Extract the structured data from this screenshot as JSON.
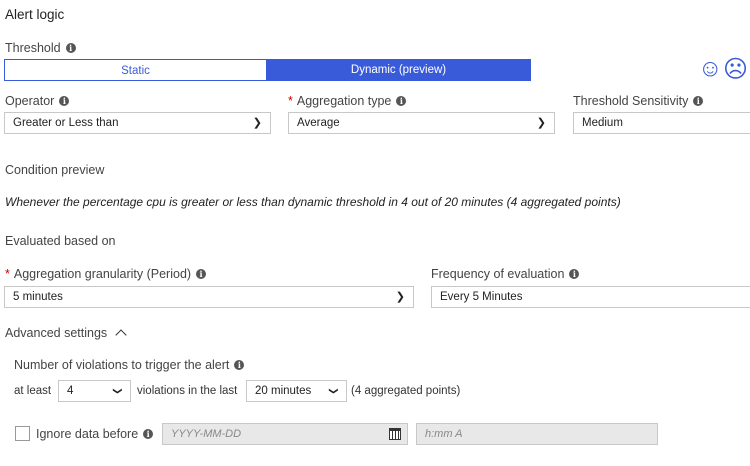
{
  "title": "Alert logic",
  "threshold": {
    "label": "Threshold",
    "options": [
      "Static",
      "Dynamic (preview)"
    ],
    "selected": "Dynamic (preview)",
    "accent": "#3a5bd9"
  },
  "feedback": {
    "positive": "☺",
    "negative": "☹"
  },
  "operator": {
    "label": "Operator",
    "value": "Greater or Less than"
  },
  "aggregation_type": {
    "label": "Aggregation type",
    "value": "Average"
  },
  "sensitivity": {
    "label": "Threshold Sensitivity",
    "value": "Medium"
  },
  "condition": {
    "heading": "Condition preview",
    "text": "Whenever the percentage cpu is greater or less than dynamic threshold in 4 out of 20 minutes (4 aggregated points)"
  },
  "evaluated": {
    "heading": "Evaluated based on",
    "granularity_label": "Aggregation granularity (Period)",
    "granularity_value": "5 minutes",
    "frequency_label": "Frequency of evaluation",
    "frequency_value": "Every 5 Minutes"
  },
  "advanced": {
    "heading": "Advanced settings",
    "violations_label": "Number of violations to trigger the alert",
    "at_least": "at least",
    "count": "4",
    "in_last": "violations in the last",
    "window": "20 minutes",
    "points": "(4 aggregated points)",
    "ignore_label": "Ignore data before",
    "date_placeholder": "YYYY-MM-DD",
    "time_placeholder": "h:mm A"
  }
}
